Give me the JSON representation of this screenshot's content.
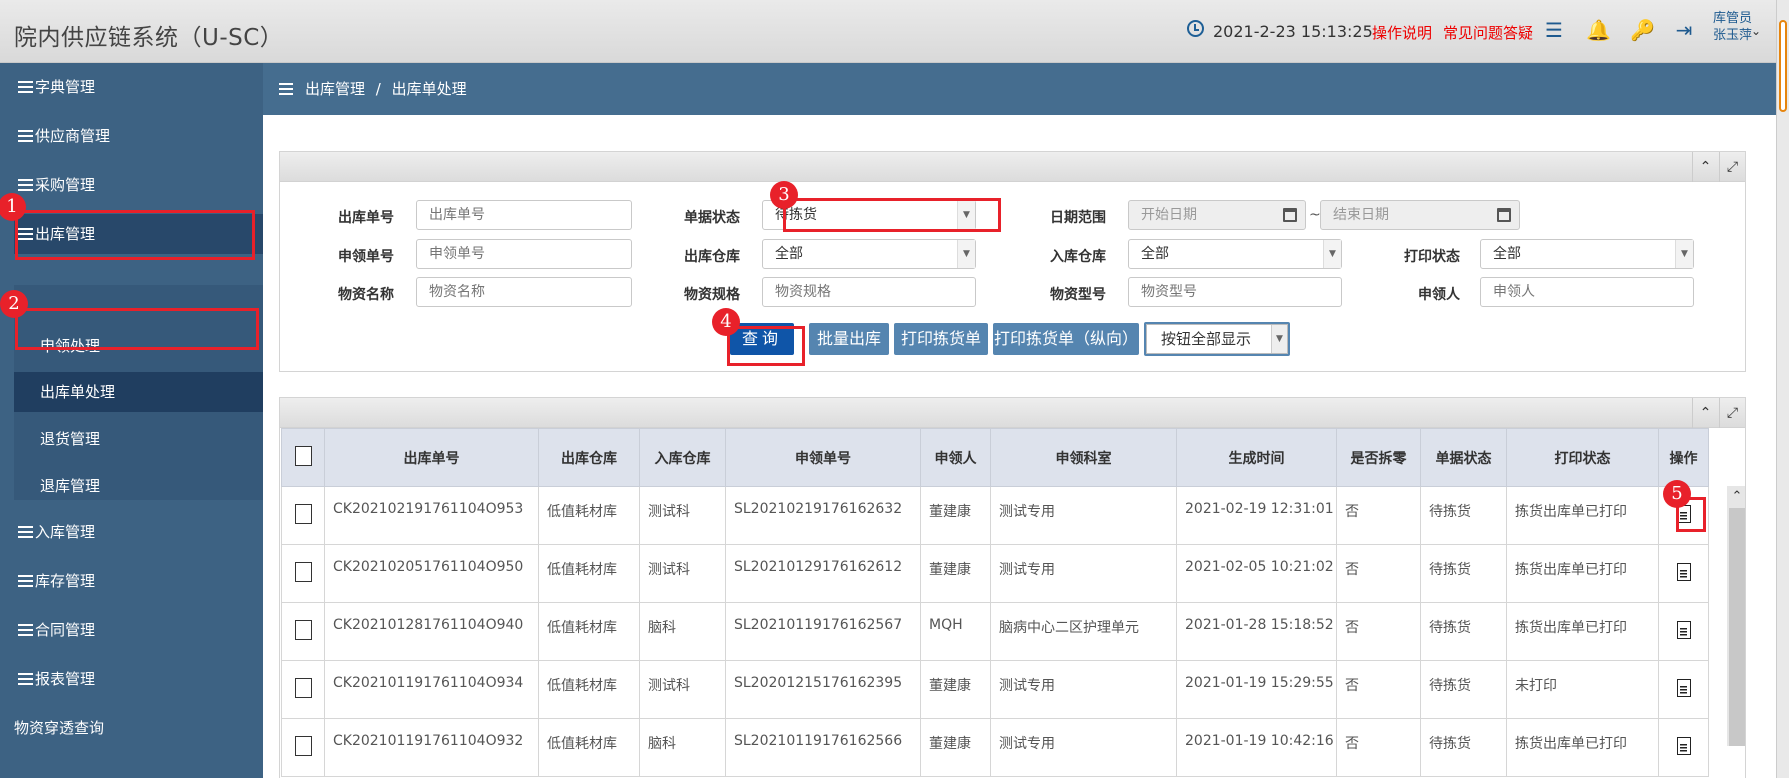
{
  "header": {
    "app_title": "院内供应链系统（U-SC）",
    "datetime": "2021-2-23  15:13:25",
    "link_help": "操作说明",
    "link_faq": "常见问题答疑",
    "user_role": "库管员",
    "user_name": "张玉萍"
  },
  "sidebar": {
    "items": [
      {
        "label": "字典管理"
      },
      {
        "label": "供应商管理"
      },
      {
        "label": "采购管理"
      },
      {
        "label": "出库管理"
      },
      {
        "label": "入库管理"
      },
      {
        "label": "库存管理"
      },
      {
        "label": "合同管理"
      },
      {
        "label": "报表管理"
      },
      {
        "label": "物资穿透查询"
      }
    ],
    "sub_items": [
      {
        "label": "申领处理"
      },
      {
        "label": "出库单处理"
      },
      {
        "label": "退货管理"
      },
      {
        "label": "退库管理"
      }
    ]
  },
  "breadcrumb": {
    "parent": "出库管理",
    "separator": "/",
    "current": "出库单处理"
  },
  "filters": {
    "out_no_label": "出库单号",
    "out_no_placeholder": "出库单号",
    "status_label": "单据状态",
    "status_value": "待拣货",
    "date_label": "日期范围",
    "date_start_placeholder": "开始日期",
    "date_sep": "~",
    "date_end_placeholder": "结束日期",
    "apply_no_label": "申领单号",
    "apply_no_placeholder": "申领单号",
    "out_wh_label": "出库仓库",
    "out_wh_value": "全部",
    "in_wh_label": "入库仓库",
    "in_wh_value": "全部",
    "print_label": "打印状态",
    "print_value": "全部",
    "item_name_label": "物资名称",
    "item_name_placeholder": "物资名称",
    "spec_label": "物资规格",
    "spec_placeholder": "物资规格",
    "model_label": "物资型号",
    "model_placeholder": "物资型号",
    "applicant_label": "申领人",
    "applicant_placeholder": "申领人"
  },
  "actions": {
    "query": "查询",
    "batch_out": "批量出库",
    "print_pick": "打印拣货单",
    "print_pick_v": "打印拣货单（纵向）",
    "show_all": "按钮全部显示"
  },
  "table": {
    "columns": [
      "出库单号",
      "出库仓库",
      "入库仓库",
      "申领单号",
      "申领人",
      "申领科室",
      "生成时间",
      "是否拆零",
      "单据状态",
      "打印状态",
      "操作"
    ],
    "rows": [
      [
        "CK202102191761104O953",
        "低值耗材库",
        "测试科",
        "SL20210219176162632",
        "董建康",
        "测试专用",
        "2021-02-19 12:31:01",
        "否",
        "待拣货",
        "拣货出库单已打印"
      ],
      [
        "CK202102051761104O950",
        "低值耗材库",
        "测试科",
        "SL20210129176162612",
        "董建康",
        "测试专用",
        "2021-02-05 10:21:02",
        "否",
        "待拣货",
        "拣货出库单已打印"
      ],
      [
        "CK202101281761104O940",
        "低值耗材库",
        "脑科",
        "SL20210119176162567",
        "MQH",
        "脑病中心二区护理单元",
        "2021-01-28 15:18:52",
        "否",
        "待拣货",
        "拣货出库单已打印"
      ],
      [
        "CK202101191761104O934",
        "低值耗材库",
        "测试科",
        "SL20201215176162395",
        "董建康",
        "测试专用",
        "2021-01-19 15:29:55",
        "否",
        "待拣货",
        "未打印"
      ],
      [
        "CK202101191761104O932",
        "低值耗材库",
        "脑科",
        "SL20210119176162566",
        "董建康",
        "测试专用",
        "2021-01-19 10:42:16",
        "否",
        "待拣货",
        "拣货出库单已打印"
      ]
    ]
  },
  "annotations": [
    "1",
    "2",
    "3",
    "4",
    "5"
  ],
  "colors": {
    "sidebar": "#3d6283",
    "crumb": "#456d8f",
    "highlight": "#e8212a",
    "primary_button": "#0f55a8"
  }
}
